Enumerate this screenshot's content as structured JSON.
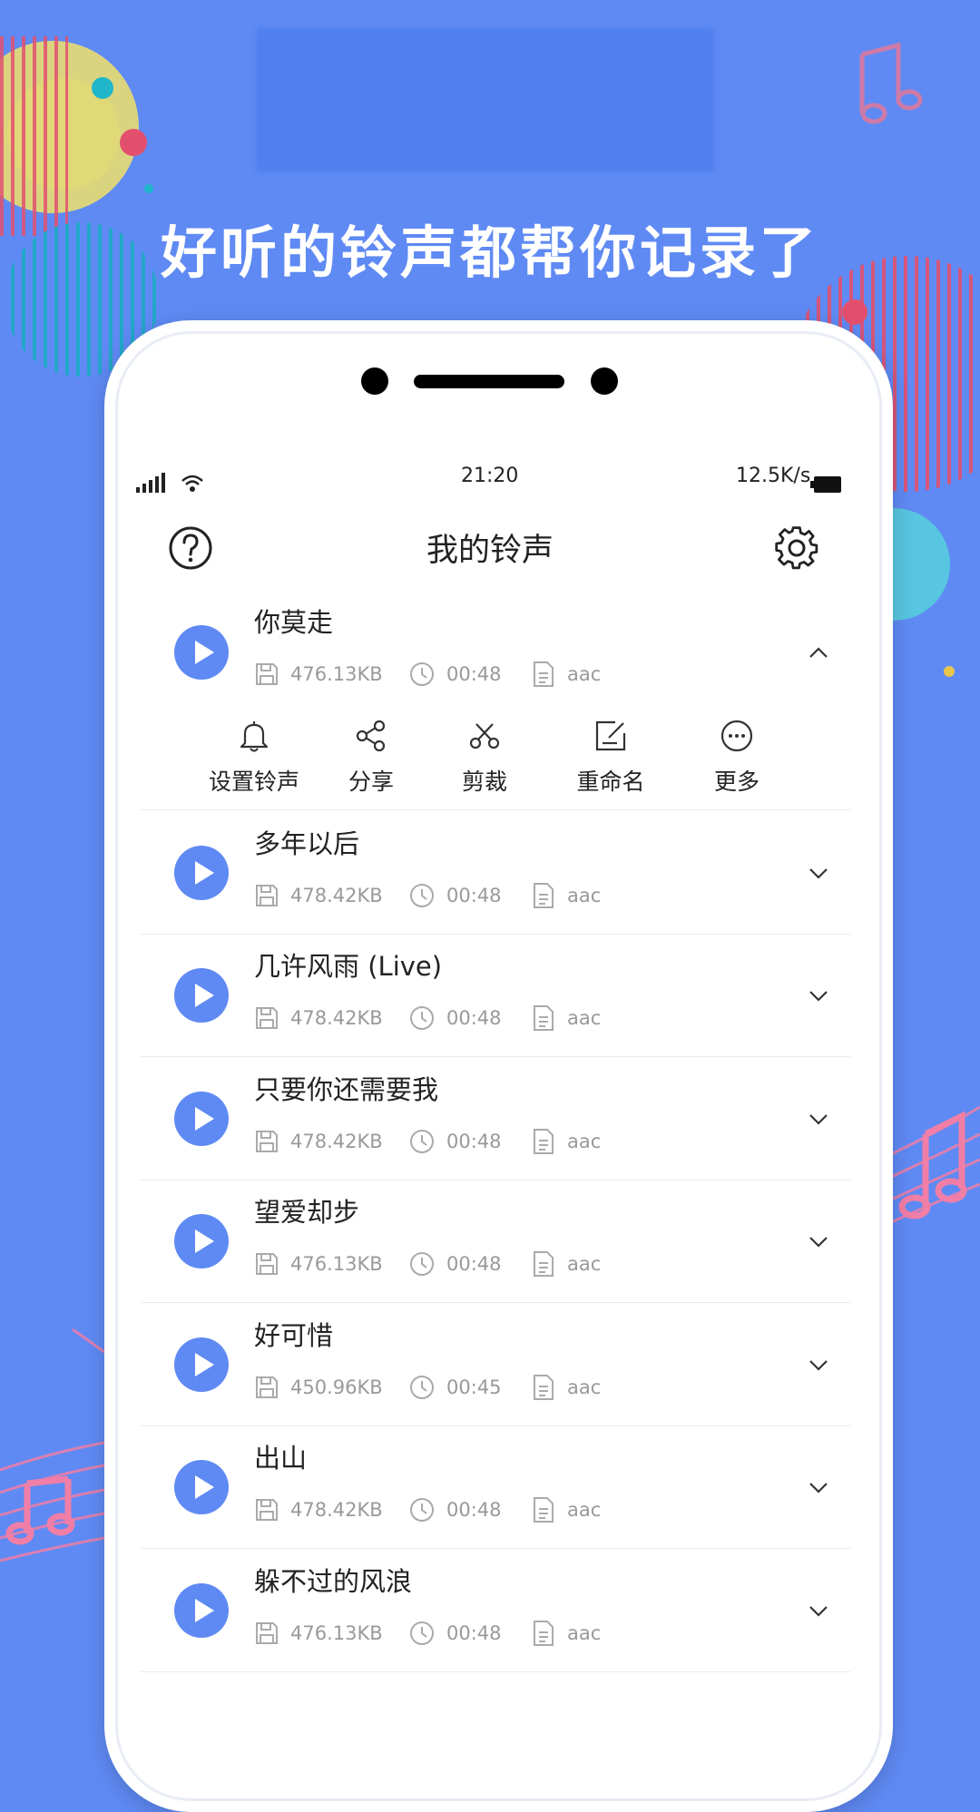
{
  "headline": "好听的铃声都帮你记录了",
  "colors": {
    "accent": "#5f8af4",
    "background": "#5f8af4",
    "text": "#222222",
    "meta_text": "#999999"
  },
  "status_bar": {
    "time": "21:20",
    "network_speed": "12.5K/s"
  },
  "header": {
    "title": "我的铃声",
    "help_icon": "help-circle-icon",
    "settings_icon": "gear-icon"
  },
  "expanded_actions": [
    {
      "label": "设置铃声",
      "icon": "bell-icon"
    },
    {
      "label": "分享",
      "icon": "share-icon"
    },
    {
      "label": "剪裁",
      "icon": "scissors-icon"
    },
    {
      "label": "重命名",
      "icon": "edit-icon"
    },
    {
      "label": "更多",
      "icon": "more-icon"
    }
  ],
  "ringtones": [
    {
      "title": "你莫走",
      "size": "476.13KB",
      "duration": "00:48",
      "format": "aac",
      "expanded": true
    },
    {
      "title": "多年以后",
      "size": "478.42KB",
      "duration": "00:48",
      "format": "aac",
      "expanded": false
    },
    {
      "title": "几许风雨 (Live)",
      "size": "478.42KB",
      "duration": "00:48",
      "format": "aac",
      "expanded": false
    },
    {
      "title": "只要你还需要我",
      "size": "478.42KB",
      "duration": "00:48",
      "format": "aac",
      "expanded": false
    },
    {
      "title": "望爱却步",
      "size": "476.13KB",
      "duration": "00:48",
      "format": "aac",
      "expanded": false
    },
    {
      "title": "好可惜",
      "size": "450.96KB",
      "duration": "00:45",
      "format": "aac",
      "expanded": false
    },
    {
      "title": "出山",
      "size": "478.42KB",
      "duration": "00:48",
      "format": "aac",
      "expanded": false
    },
    {
      "title": "躲不过的风浪",
      "size": "476.13KB",
      "duration": "00:48",
      "format": "aac",
      "expanded": false
    }
  ]
}
